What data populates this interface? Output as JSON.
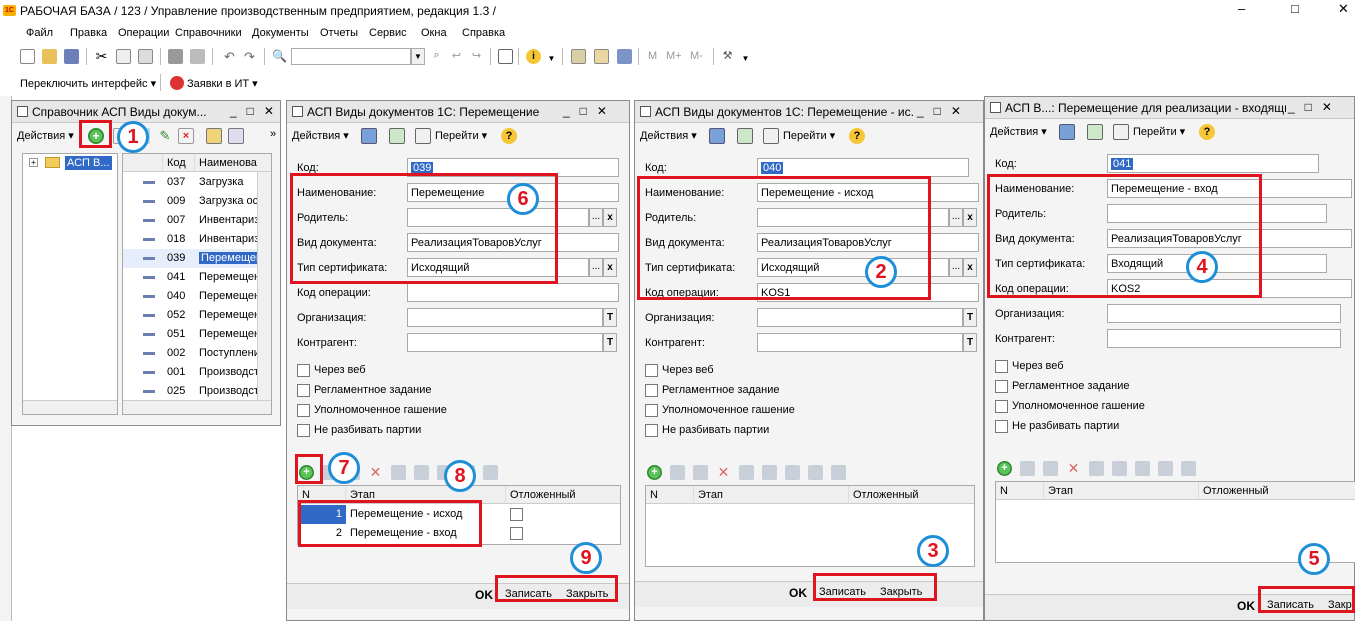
{
  "app": {
    "title": "РАБОЧАЯ БАЗА / 123 /  Управление производственным предприятием, редакция 1.3 /",
    "window_controls": [
      "–",
      "□",
      "✕"
    ]
  },
  "menu": [
    "Файл",
    "Правка",
    "Операции",
    "Справочники",
    "Документы",
    "Отчеты",
    "Сервис",
    "Окна",
    "Справка"
  ],
  "toolbar2": {
    "switch_interface": "Переключить интерфейс",
    "it_requests": "Заявки в ИТ"
  },
  "toolbar_misc": {
    "m": "M",
    "mplus": "M+",
    "mminus": "M-"
  },
  "common": {
    "actions": "Действия",
    "goto": "Перейти",
    "ok": "OK",
    "save": "Записать",
    "close": "Закрыть",
    "ellipsis": "...",
    "clear": "x",
    "type_btn": "T"
  },
  "labels": {
    "code": "Код:",
    "name": "Наименование:",
    "parent": "Родитель:",
    "doc_type": "Вид документа:",
    "cert_type": "Тип сертификата:",
    "operation_code": "Код операции:",
    "organization": "Организация:",
    "counterparty": "Контрагент:",
    "via_web": "Через веб",
    "scheduled_task": "Регламентное задание",
    "authorized_cancel": "Уполномоченное гашение",
    "no_split": "Не разбивать партии",
    "col_n": "N",
    "col_stage": "Этап",
    "col_deferred": "Отложенный"
  },
  "catalog": {
    "title": "Справочник АСП Виды докум...",
    "tree_root": "АСП В...",
    "col_code": "Код",
    "col_name": "Наименова",
    "rows": [
      {
        "code": "037",
        "name": "Загрузка"
      },
      {
        "code": "009",
        "name": "Загрузка ос"
      },
      {
        "code": "007",
        "name": "Инвентариз"
      },
      {
        "code": "018",
        "name": "Инвентариз"
      },
      {
        "code": "039",
        "name": "Перемещен"
      },
      {
        "code": "041",
        "name": "Перемещен"
      },
      {
        "code": "040",
        "name": "Перемещен"
      },
      {
        "code": "052",
        "name": "Перемещен"
      },
      {
        "code": "051",
        "name": "Перемещен"
      },
      {
        "code": "002",
        "name": "Поступлени"
      },
      {
        "code": "001",
        "name": "Производст"
      },
      {
        "code": "025",
        "name": "Производст"
      }
    ]
  },
  "form1": {
    "title": "АСП Виды документов 1С: Перемещение",
    "code": "039",
    "name": "Перемещение",
    "parent": "",
    "doc_type": "РеализацияТоваровУслуг",
    "cert_type": "Исходящий",
    "operation_code": "",
    "stages": [
      {
        "n": "1",
        "stage": "Перемещение - исход"
      },
      {
        "n": "2",
        "stage": "Перемещение - вход"
      }
    ]
  },
  "form2": {
    "title": "АСП Виды документов 1С: Перемещение - ис...",
    "code": "040",
    "name": "Перемещение - исход",
    "parent": "",
    "doc_type": "РеализацияТоваровУслуг",
    "cert_type": "Исходящий",
    "operation_code": "KOS1"
  },
  "form3": {
    "title": "АСП В...: Перемещение для реализации - входящий",
    "code": "041",
    "name": "Перемещение - вход",
    "parent": "",
    "doc_type": "РеализацияТоваровУслуг",
    "cert_type": "Входящий",
    "operation_code": "KOS2",
    "save_partial": "Записать",
    "close_partial": "Закр"
  },
  "badges": [
    "1",
    "2",
    "3",
    "4",
    "5",
    "6",
    "7",
    "8",
    "9"
  ],
  "colors": {
    "highlight_red": "#e0141e",
    "badge_ring": "#1e8fd6",
    "selection": "#3169c6"
  }
}
